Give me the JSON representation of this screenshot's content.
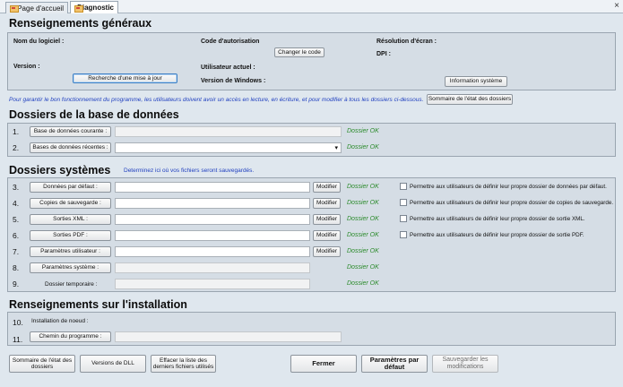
{
  "tabs": [
    {
      "label": "Page d'accueil",
      "active": false
    },
    {
      "label": "Diagnostic",
      "active": true
    }
  ],
  "close_glyph": "×",
  "general": {
    "title": "Renseignements généraux",
    "software_name_label": "Nom du logiciel :",
    "version_label": "Version :",
    "check_update_button": "Recherche d'une mise à jour",
    "auth_code_label": "Code d'autorisation",
    "change_code_button": "Changer le code",
    "current_user_label": "Utilisateur actuel :",
    "windows_version_label": "Version de Windows :",
    "screen_resolution_label": "Résolution d'écran :",
    "dpi_label": "DPI :",
    "system_info_button": "Information système"
  },
  "notice": "Pour garantir le bon fonctionnement du programme, les utilisateurs doivent avoir un accès en lecture, en écriture, et pour modifier à tous les dossiers ci-dessous.",
  "folder_status_summary_button": "Sommaire de l'état des dossiers",
  "database": {
    "title": "Dossiers de la base de données",
    "rows": [
      {
        "num": "1.",
        "button": "Base de données courante :",
        "status": "Dossier OK"
      },
      {
        "num": "2.",
        "button": "Bases de données récentes :",
        "status": "Dossier OK"
      }
    ],
    "dropdown_arrow": "▾"
  },
  "system": {
    "title": "Dossiers systèmes",
    "subtitle": "Determinez ici où vos fichiers seront sauvegardés.",
    "modify_label": "Modifier",
    "rows": [
      {
        "num": "3.",
        "button": "Données par défaut :",
        "status": "Dossier OK",
        "checkbox_label": "Permettre aux utilisateurs de définir leur propre dossier de données par défaut."
      },
      {
        "num": "4.",
        "button": "Copies de sauvegarde :",
        "status": "Dossier OK",
        "checkbox_label": "Permettre aux utilisateurs de définir leur propre dossier de copies de sauvegarde."
      },
      {
        "num": "5.",
        "button": "Sorties XML :",
        "status": "Dossier OK",
        "checkbox_label": "Permettre aux utilisateurs de définir leur propre dossier de sortie XML."
      },
      {
        "num": "6.",
        "button": "Sorties PDF :",
        "status": "Dossier OK",
        "checkbox_label": "Permettre aux utilisateurs de définir leur propre dossier de sortie PDF."
      },
      {
        "num": "7.",
        "button": "Paramètres utilisateur :",
        "status": "Dossier OK"
      },
      {
        "num": "8.",
        "button": "Paramètres système :",
        "status": "Dossier OK"
      },
      {
        "num": "9.",
        "label": "Dossier temporaire :",
        "status": "Dossier OK"
      }
    ]
  },
  "install": {
    "title": "Renseignements sur l'installation",
    "node_num": "10.",
    "node_label": "Installation de noeud :",
    "path_num": "11.",
    "path_button": "Chemin du programme :"
  },
  "footer": {
    "folder_summary": "Sommaire de l'état des dossiers",
    "dll_versions": "Versions de DLL",
    "clear_recent": "Effacer la liste des derniers fichiers utilisés",
    "close": "Fermer",
    "default_params": "Paramètres par défaut",
    "save_changes": "Sauvegarder les modifications"
  }
}
